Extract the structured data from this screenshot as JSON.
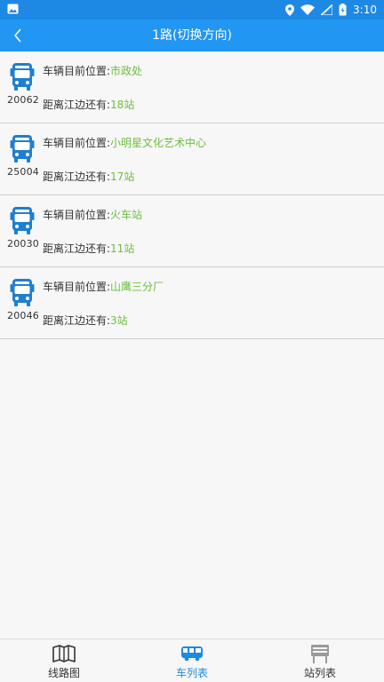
{
  "status_bar": {
    "time": "3:10"
  },
  "header": {
    "title": "1路(切换方向)"
  },
  "buses": [
    {
      "number": "20062",
      "location_label": "车辆目前位置:",
      "location": "市政处",
      "distance_label": "距离江边还有:",
      "distance": "18站"
    },
    {
      "number": "25004",
      "location_label": "车辆目前位置:",
      "location": "小明星文化艺术中心",
      "distance_label": "距离江边还有:",
      "distance": "17站"
    },
    {
      "number": "20030",
      "location_label": "车辆目前位置:",
      "location": "火车站",
      "distance_label": "距离江边还有:",
      "distance": "11站"
    },
    {
      "number": "20046",
      "location_label": "车辆目前位置:",
      "location": "山鹰三分厂",
      "distance_label": "距离江边还有:",
      "distance": "3站"
    }
  ],
  "tabs": [
    {
      "label": "线路图",
      "icon": "map-icon",
      "active": false
    },
    {
      "label": "车列表",
      "icon": "bus-icon",
      "active": true
    },
    {
      "label": "站列表",
      "icon": "bus-stop-icon",
      "active": false
    }
  ],
  "colors": {
    "primary": "#2196f3",
    "accent_green": "#6cbf3c",
    "bus_icon": "#1e7fcf"
  }
}
